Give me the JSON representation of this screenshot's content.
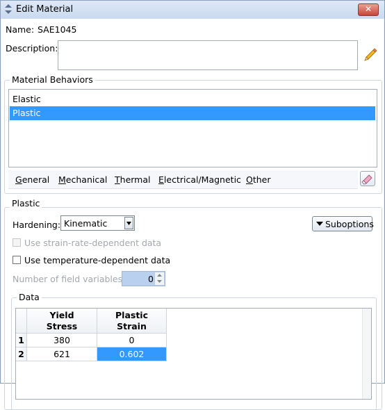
{
  "window": {
    "title": "Edit Material",
    "close_label": "✕"
  },
  "name": {
    "label": "Name:",
    "value": "SAE1045"
  },
  "description": {
    "label": "Description:",
    "value": ""
  },
  "behaviors": {
    "title": "Material Behaviors",
    "items": [
      {
        "label": "Elastic"
      },
      {
        "label": "Plastic"
      }
    ],
    "selected": "Plastic"
  },
  "menu": {
    "items": [
      {
        "label": "General",
        "mnemonic": "G",
        "rest": "eneral"
      },
      {
        "label": "Mechanical",
        "mnemonic": "M",
        "rest": "echanical"
      },
      {
        "label": "Thermal",
        "mnemonic": "T",
        "rest": "hermal"
      },
      {
        "label": "Electrical/Magnetic",
        "mnemonic": "E",
        "rest": "lectrical/Magnetic"
      },
      {
        "label": "Other",
        "mnemonic": "O",
        "rest": "ther"
      }
    ]
  },
  "plastic": {
    "title": "Plastic",
    "hardening_label": "Hardening:",
    "hardening_value": "Kinematic",
    "suboptions_label": "Suboptions",
    "strain_rate_label": "Use strain-rate-dependent data",
    "strain_rate_checked": false,
    "strain_rate_enabled": false,
    "temperature_label": "Use temperature-dependent data",
    "temperature_checked": false,
    "field_vars_label": "Number of field variables:",
    "field_vars_value": "0"
  },
  "data_table": {
    "title": "Data",
    "columns": [
      {
        "line1": "Yield",
        "line2": "Stress"
      },
      {
        "line1": "Plastic",
        "line2": "Strain"
      }
    ],
    "rows": [
      {
        "index": "1",
        "values": [
          "380",
          "0"
        ]
      },
      {
        "index": "2",
        "values": [
          "621",
          "0.602"
        ]
      }
    ],
    "selected_cell": {
      "row": 1,
      "col": 1
    }
  },
  "colors": {
    "selection": "#3399ff",
    "title_bar": "#c9d9ef",
    "close_button": "#c6453a"
  }
}
